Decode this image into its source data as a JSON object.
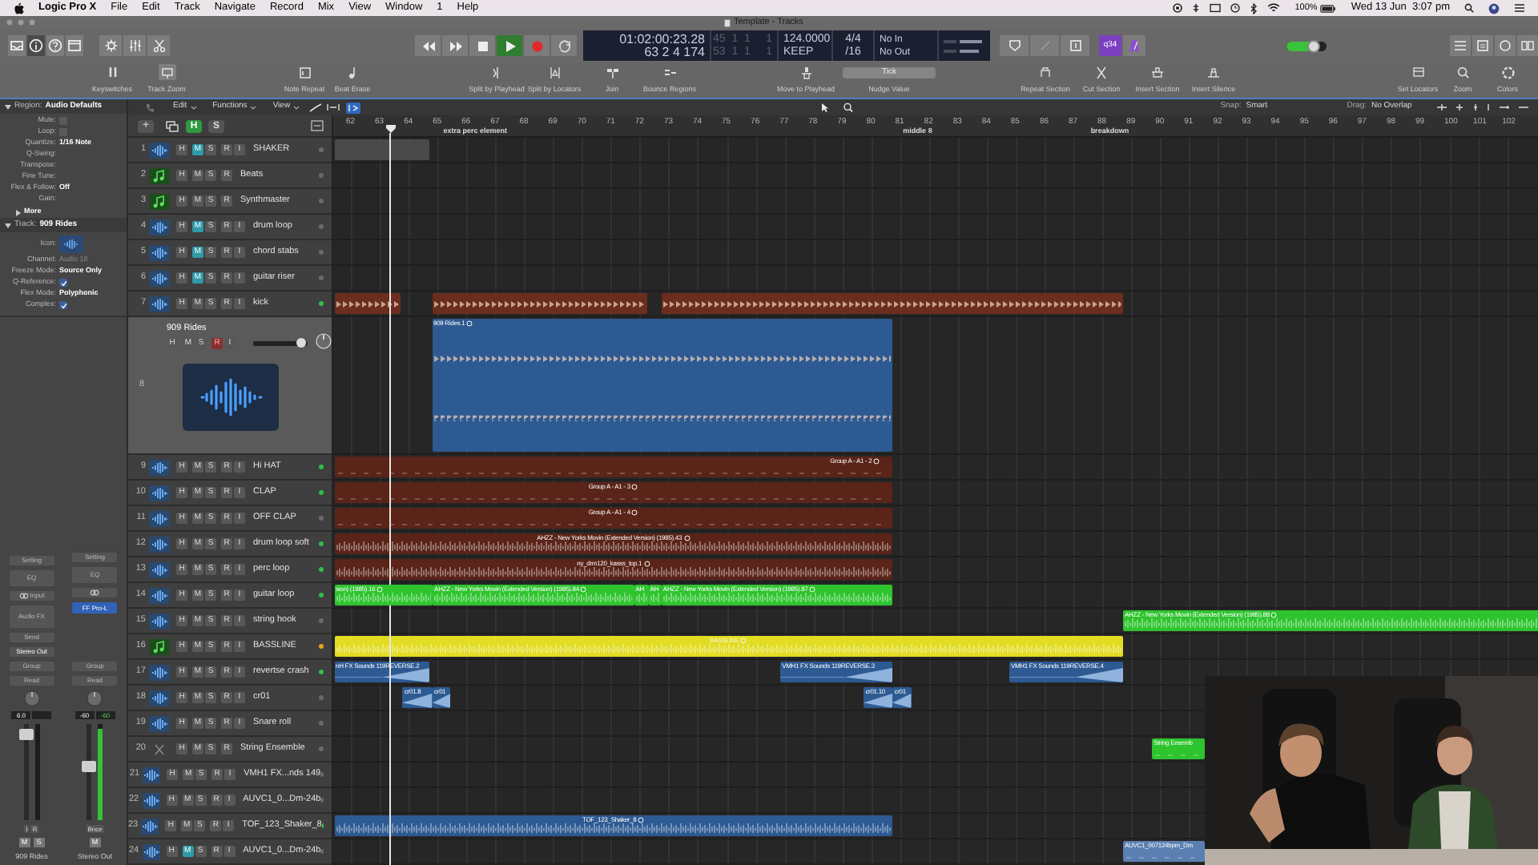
{
  "menu_bar": {
    "app": "Logic Pro X",
    "menus": [
      "File",
      "Edit",
      "Track",
      "Navigate",
      "Record",
      "Mix",
      "View",
      "Window",
      "1",
      "Help"
    ],
    "battery": "100%",
    "clock": "Wed 13 Jun  3:07 pm"
  },
  "window": {
    "title": "Template - Tracks"
  },
  "transport": [
    {
      "kind": "rewind",
      "on": false
    },
    {
      "kind": "forward",
      "on": false
    },
    {
      "kind": "stop",
      "on": false
    },
    {
      "kind": "play",
      "on": true
    },
    {
      "kind": "record",
      "on": false
    },
    {
      "kind": "cycle",
      "on": false
    }
  ],
  "lcd": {
    "time": "01:02:00:23.28",
    "bars": "63  2  4  174",
    "locator_start": "45  1  1     1",
    "locator_end": "53  1  1     1",
    "tempo": "124.0000",
    "tempo_mode": "KEEP",
    "signature": "4/4",
    "division": "/16",
    "input": "No In",
    "output": "No Out"
  },
  "count_in": "q34",
  "master_volume": {
    "level": 0.68
  },
  "toolbar": [
    [
      {
        "kind": "button",
        "label": "Keyswitches",
        "on": false
      },
      {
        "kind": "button",
        "label": "Track Zoom",
        "on": true
      }
    ],
    [
      {
        "kind": "button",
        "label": "Note Repeat",
        "on": false
      },
      {
        "kind": "button",
        "label": "Beat Erase",
        "on": false
      }
    ],
    [
      {
        "kind": "button",
        "label": "Split by Playhead",
        "on": false
      },
      {
        "kind": "button",
        "label": "Split by Locators",
        "on": false
      },
      {
        "kind": "button",
        "label": "Join",
        "on": false
      },
      {
        "kind": "button",
        "label": "Bounce Regions",
        "on": false
      }
    ],
    [
      {
        "kind": "button",
        "label": "Move to Playhead",
        "on": false
      },
      {
        "kind": "selector",
        "label": "Nudge Value",
        "value": "Tick"
      }
    ],
    [
      {
        "kind": "button",
        "label": "Repeat Section",
        "on": false
      },
      {
        "kind": "button",
        "label": "Cut Section",
        "on": false
      },
      {
        "kind": "button",
        "label": "Insert Section",
        "on": false
      },
      {
        "kind": "button",
        "label": "Insert Silence",
        "on": false
      }
    ],
    [
      {
        "kind": "button",
        "label": "Set Locators",
        "on": false
      },
      {
        "kind": "button",
        "label": "Zoom",
        "on": false
      },
      {
        "kind": "button",
        "label": "Colors",
        "on": false
      }
    ]
  ],
  "inspector": {
    "region": {
      "prefix": "Region:",
      "name": "Audio Defaults",
      "fields": [
        {
          "label": "Mute:",
          "kind": "checkbox",
          "checked": false
        },
        {
          "label": "Loop:",
          "kind": "checkbox",
          "checked": false
        },
        {
          "label": "Quantize:",
          "kind": "value",
          "value": "1/16 Note"
        },
        {
          "label": "Q-Swing:",
          "kind": "empty"
        },
        {
          "label": "Transpose:",
          "kind": "empty"
        },
        {
          "label": "Fine Tune:",
          "kind": "empty"
        },
        {
          "label": "Flex & Follow:",
          "kind": "value",
          "value": "Off"
        },
        {
          "label": "Gain:",
          "kind": "empty"
        }
      ],
      "more": "More"
    },
    "track": {
      "prefix": "Track:",
      "name": "909 Rides",
      "fields": [
        {
          "label": "Icon:",
          "kind": "icon"
        },
        {
          "label": "Channel:",
          "kind": "readonly",
          "value": "Audio 18"
        },
        {
          "label": "Freeze Mode:",
          "kind": "value",
          "value": "Source Only"
        },
        {
          "label": "Q-Reference:",
          "kind": "checkbox",
          "checked": true
        },
        {
          "label": "Flex Mode:",
          "kind": "value",
          "value": "Polyphonic"
        },
        {
          "label": "Complex:",
          "kind": "checkbox",
          "checked": true
        }
      ]
    }
  },
  "channel_strips": [
    {
      "setting": "Setting",
      "eq": "EQ",
      "input": "Input",
      "insert": {
        "kind": "empty",
        "label": "Audio FX"
      },
      "send": "Send",
      "output": "Stereo Out",
      "group": "Group",
      "automation": "Read",
      "volume": "6.0",
      "fader": {
        "level": 0.9
      },
      "buttons": [
        "I",
        "R"
      ],
      "mute_solo": [
        "M",
        "S"
      ],
      "name": "909 Rides"
    },
    {
      "setting": "Setting",
      "eq": "EQ",
      "insert": {
        "kind": "plugin",
        "label": "FF Pro-L"
      },
      "group": "Group",
      "automation": "Read",
      "volume": "-60",
      "peak": "-60",
      "fader": {
        "level": 0.56
      },
      "meter": {
        "level": 0.95
      },
      "buttons": [
        "Bnce"
      ],
      "mute_solo": [
        "M"
      ],
      "name": "Stereo Out"
    }
  ],
  "tracks_menu": [
    "Edit",
    "Functions",
    "View"
  ],
  "snap": {
    "label": "Snap:",
    "value": "Smart"
  },
  "drag": {
    "label": "Drag:",
    "value": "No Overlap"
  },
  "track_header_buttons": [
    {
      "label": "+",
      "on": false
    },
    {
      "label": "H",
      "on": true
    },
    {
      "label": "S",
      "on": false
    }
  ],
  "ruler": {
    "bars": [
      "62",
      "63",
      "64",
      "65",
      "66",
      "67",
      "68",
      "69",
      "70",
      "71",
      "72",
      "73",
      "74",
      "75",
      "76",
      "77",
      "78",
      "79",
      "80",
      "81",
      "82",
      "83",
      "84",
      "85",
      "86",
      "87",
      "88",
      "89",
      "90",
      "91",
      "92",
      "93",
      "94",
      "95",
      "96",
      "97",
      "98",
      "99",
      "100",
      "101",
      "102"
    ],
    "markers": [
      "extra perc element",
      "middle 8",
      "breakdown"
    ]
  },
  "tracks": [
    {
      "number": "1",
      "name": "SHAKER",
      "kind": "audio",
      "buttons": [
        "H",
        "M",
        "S",
        "R",
        "I"
      ],
      "muted": true,
      "armed": false,
      "selected": false,
      "expanded": false,
      "color": "#6a6a6a",
      "regions": [
        {
          "color": "#4a4a4a",
          "kind": "none",
          "info_icon": false
        }
      ]
    },
    {
      "number": "2",
      "name": "Beats",
      "kind": "instrument",
      "buttons": [
        "H",
        "M",
        "S",
        "R"
      ],
      "muted": false,
      "armed": false,
      "selected": false,
      "expanded": false,
      "color": "#6a6a6a"
    },
    {
      "number": "3",
      "name": "Synthmaster",
      "kind": "instrument",
      "buttons": [
        "H",
        "M",
        "S",
        "R"
      ],
      "muted": false,
      "armed": false,
      "selected": false,
      "expanded": false,
      "color": "#6a6a6a"
    },
    {
      "number": "4",
      "name": "drum loop",
      "kind": "audio",
      "buttons": [
        "H",
        "M",
        "S",
        "R",
        "I"
      ],
      "muted": true,
      "armed": false,
      "selected": false,
      "expanded": false,
      "color": "#6a6a6a"
    },
    {
      "number": "5",
      "name": "chord stabs",
      "kind": "audio",
      "buttons": [
        "H",
        "M",
        "S",
        "R",
        "I"
      ],
      "muted": true,
      "armed": false,
      "selected": false,
      "expanded": false,
      "color": "#6a6a6a"
    },
    {
      "number": "6",
      "name": "guitar riser",
      "kind": "audio",
      "buttons": [
        "H",
        "M",
        "S",
        "R",
        "I"
      ],
      "muted": true,
      "armed": false,
      "selected": false,
      "expanded": false,
      "color": "#6a6a6a"
    },
    {
      "number": "7",
      "name": "kick",
      "kind": "audio",
      "buttons": [
        "H",
        "M",
        "S",
        "R",
        "I"
      ],
      "muted": false,
      "armed": false,
      "selected": false,
      "expanded": false,
      "color": "#2fbf4a",
      "regions": [
        {
          "color": "#6b2e1c",
          "kind": "pulses",
          "info_icon": false
        },
        {
          "color": "#6b2e1c",
          "kind": "pulses",
          "info_icon": false
        },
        {
          "color": "#6b2e1c",
          "kind": "pulses",
          "info_icon": false
        }
      ]
    },
    {
      "number": "8",
      "name": "909 Rides",
      "kind": "audio",
      "buttons": [
        "H",
        "M",
        "S",
        "R",
        "I"
      ],
      "muted": false,
      "armed": true,
      "selected": true,
      "expanded": true,
      "volume": {
        "level": 0.88
      },
      "regions": [
        {
          "color": "#2d5a92",
          "kind": "pulses",
          "label": "909 Rides.1",
          "info_icon": true
        }
      ]
    },
    {
      "number": "9",
      "name": "Hi HAT",
      "kind": "audio",
      "buttons": [
        "H",
        "M",
        "S",
        "R",
        "I"
      ],
      "muted": false,
      "armed": false,
      "selected": false,
      "expanded": false,
      "color": "#2fbf4a",
      "regions": [
        {
          "color": "#5a2418",
          "kind": "flat",
          "label": "Group A - A1 - 2",
          "info_icon": true
        }
      ]
    },
    {
      "number": "10",
      "name": "CLAP",
      "kind": "audio",
      "buttons": [
        "H",
        "M",
        "S",
        "R",
        "I"
      ],
      "muted": false,
      "armed": false,
      "selected": false,
      "expanded": false,
      "color": "#2fbf4a",
      "regions": [
        {
          "color": "#5a2418",
          "kind": "flat",
          "label": "Group A - A1 - 3",
          "info_icon": true
        }
      ]
    },
    {
      "number": "11",
      "name": "OFF CLAP",
      "kind": "audio",
      "buttons": [
        "H",
        "M",
        "S",
        "R",
        "I"
      ],
      "muted": false,
      "armed": false,
      "selected": false,
      "expanded": false,
      "color": "#6a6a6a",
      "regions": [
        {
          "color": "#5a2418",
          "kind": "flat",
          "label": "Group A - A1 - 4",
          "info_icon": true
        }
      ]
    },
    {
      "number": "12",
      "name": "drum loop soft",
      "kind": "audio",
      "buttons": [
        "H",
        "M",
        "S",
        "R",
        "I"
      ],
      "muted": false,
      "armed": false,
      "selected": false,
      "expanded": false,
      "color": "#2fbf4a",
      "regions": [
        {
          "color": "#5a2418",
          "kind": "wave",
          "label": "AHZZ - New Yorks Movin  (Extended Version) (1985).43",
          "info_icon": true
        }
      ]
    },
    {
      "number": "13",
      "name": "perc loop",
      "kind": "audio",
      "buttons": [
        "H",
        "M",
        "S",
        "R",
        "I"
      ],
      "muted": false,
      "armed": false,
      "selected": false,
      "expanded": false,
      "color": "#2fbf4a",
      "regions": [
        {
          "color": "#5a2418",
          "kind": "wave",
          "label": "ny_drm120_kasss_top.1",
          "info_icon": true
        }
      ]
    },
    {
      "number": "14",
      "name": "guitar loop",
      "kind": "audio",
      "buttons": [
        "H",
        "M",
        "S",
        "R",
        "I"
      ],
      "muted": false,
      "armed": false,
      "selected": false,
      "expanded": false,
      "color": "#2fbf4a",
      "regions": [
        {
          "color": "#2ec42e",
          "kind": "wave",
          "label": "sion) (1985).16",
          "info_icon": true
        },
        {
          "color": "#2ec42e",
          "kind": "wave",
          "label": "AHZZ - New Yorks Movin  (Extended Version) (1985).84",
          "info_icon": true
        },
        {
          "color": "#2ec42e",
          "kind": "wave",
          "label": "AH",
          "info_icon": false
        },
        {
          "color": "#2ec42e",
          "kind": "wave",
          "label": "AH",
          "info_icon": false
        },
        {
          "color": "#2ec42e",
          "kind": "wave",
          "label": "AHZZ - New Yorks Movin  (Extended Version) (1985).87",
          "info_icon": true
        }
      ]
    },
    {
      "number": "15",
      "name": "string hook",
      "kind": "audio",
      "buttons": [
        "H",
        "M",
        "S",
        "R",
        "I"
      ],
      "muted": false,
      "armed": false,
      "selected": false,
      "expanded": false,
      "color": "#6a6a6a",
      "regions": [
        {
          "color": "#2ec42e",
          "kind": "wave",
          "label": "AHZZ - New Yorks Movin  (Extended Version) (1985).88",
          "info_icon": true
        }
      ]
    },
    {
      "number": "16",
      "name": "BASSLINE",
      "kind": "instrument",
      "buttons": [
        "H",
        "M",
        "S",
        "R",
        "I"
      ],
      "muted": false,
      "armed": false,
      "selected": false,
      "expanded": false,
      "color": "#e3a21a",
      "regions": [
        {
          "color": "#e2dc22",
          "kind": "wave",
          "label": "BASSLINE",
          "info_icon": true
        }
      ]
    },
    {
      "number": "17",
      "name": "revertse crash",
      "kind": "audio",
      "buttons": [
        "H",
        "M",
        "S",
        "R",
        "I"
      ],
      "muted": false,
      "armed": false,
      "selected": false,
      "expanded": false,
      "color": "#2fbf4a",
      "regions": [
        {
          "color": "#2d5a92",
          "kind": "swell",
          "label": "nH FX Sounds 119REVERSE.2",
          "info_icon": false
        },
        {
          "color": "#2d5a92",
          "kind": "swell",
          "label": "VMH1 FX Sounds 119REVERSE.3",
          "info_icon": false
        },
        {
          "color": "#2d5a92",
          "kind": "swell",
          "label": "VMH1 FX Sounds 119REVERSE.4",
          "info_icon": false
        }
      ]
    },
    {
      "number": "18",
      "name": "cr01",
      "kind": "audio",
      "buttons": [
        "H",
        "M",
        "S",
        "R",
        "I"
      ],
      "muted": false,
      "armed": false,
      "selected": false,
      "expanded": false,
      "color": "#6a6a6a",
      "regions": [
        {
          "color": "#2d5a92",
          "kind": "swell",
          "label": "cr01.8",
          "info_icon": false
        },
        {
          "color": "#2d5a92",
          "kind": "swell",
          "label": "cr01",
          "info_icon": false
        },
        {
          "color": "#2d5a92",
          "kind": "swell",
          "label": "cr01.10",
          "info_icon": false
        },
        {
          "color": "#2d5a92",
          "kind": "swell",
          "label": "cr01",
          "info_icon": false
        }
      ]
    },
    {
      "number": "19",
      "name": "Snare roll",
      "kind": "audio",
      "buttons": [
        "H",
        "M",
        "S",
        "R",
        "I"
      ],
      "muted": false,
      "armed": false,
      "selected": false,
      "expanded": false,
      "color": "#6a6a6a"
    },
    {
      "number": "20",
      "name": "String Ensemble",
      "kind": "none",
      "buttons": [
        "H",
        "M",
        "S",
        "R"
      ],
      "muted": false,
      "armed": false,
      "selected": false,
      "expanded": false,
      "color": "#6a6a6a",
      "regions": [
        {
          "color": "#2ec42e",
          "kind": "flat",
          "label": "String Ensemb",
          "info_icon": false
        }
      ]
    },
    {
      "number": "21",
      "name": "VMH1 FX...nds 149",
      "kind": "audio",
      "buttons": [
        "H",
        "M",
        "S",
        "R",
        "I"
      ],
      "muted": false,
      "armed": false,
      "selected": false,
      "expanded": false,
      "color": "#6a6a6a"
    },
    {
      "number": "22",
      "name": "AUVC1_0...Dm-24b",
      "kind": "audio",
      "buttons": [
        "H",
        "M",
        "S",
        "R",
        "I"
      ],
      "muted": false,
      "armed": false,
      "selected": false,
      "expanded": false,
      "color": "#6a6a6a"
    },
    {
      "number": "23",
      "name": "TOF_123_Shaker_8",
      "kind": "audio",
      "buttons": [
        "H",
        "M",
        "S",
        "R",
        "I"
      ],
      "muted": false,
      "armed": false,
      "selected": false,
      "expanded": false,
      "color": "#2fbf4a",
      "regions": [
        {
          "color": "#2d5a92",
          "kind": "wave",
          "label": "TOF_123_Shaker_8",
          "info_icon": true
        }
      ]
    },
    {
      "number": "24",
      "name": "AUVC1_0...Dm-24b",
      "kind": "audio",
      "buttons": [
        "H",
        "M",
        "S",
        "R",
        "I"
      ],
      "muted": true,
      "armed": false,
      "selected": false,
      "expanded": false,
      "color": "#6a6a6a",
      "regions": [
        {
          "color": "#5a7fb0",
          "kind": "flat",
          "label": "AUVC1_007124bpm_Dm",
          "info_icon": false
        }
      ]
    }
  ],
  "video_overlay": {
    "kind": "picture"
  }
}
